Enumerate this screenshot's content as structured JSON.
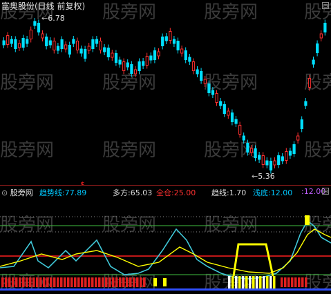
{
  "main": {
    "title": "富奥股份(日线 前复权)",
    "high_label": "6.78",
    "low_label": "5.36",
    "signal_glyph": "$"
  },
  "sub": {
    "name": "股旁网",
    "indicators": [
      {
        "label": "趋势线:",
        "value": "77.89",
        "color": "#00c8ff"
      },
      {
        "label": "多方:",
        "value": "65.03",
        "color": "#dddddd"
      },
      {
        "label": "全仓:",
        "value": "25.00",
        "color": "#ff3030"
      },
      {
        "label": "趋线:",
        "value": "1.70",
        "color": "#dddddd"
      },
      {
        "label": "浅底:",
        "value": "12.00",
        "color": "#00c8ff"
      },
      {
        "label": ":",
        "value": "12.00",
        "color": "#c060ff"
      }
    ]
  },
  "watermark": "股旁网",
  "colors": {
    "up": "#ff3030",
    "down": "#00e0ff",
    "yellow": "#ffff00",
    "green_line": "#40c040",
    "red_line": "#ff2020"
  }
}
